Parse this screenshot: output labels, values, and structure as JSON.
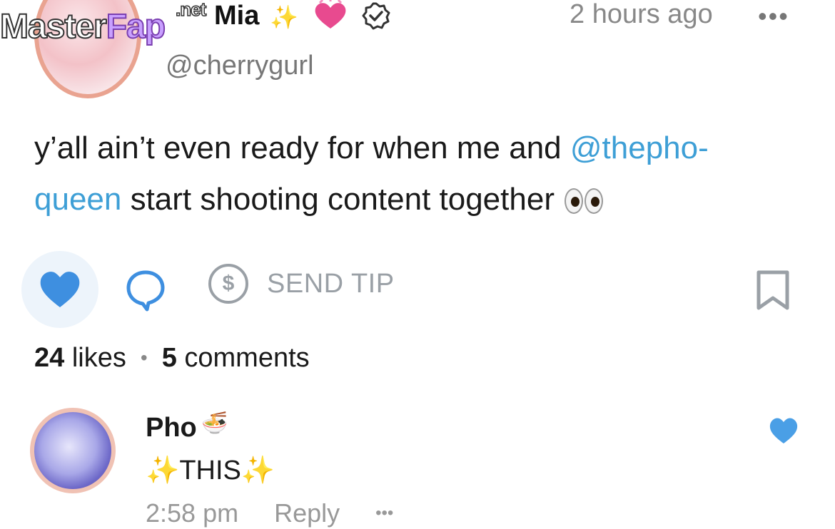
{
  "watermark": {
    "master": "Master",
    "fap": "Fap",
    "net": ".net"
  },
  "post": {
    "author_name": "Mia",
    "sparkles": "✨",
    "heart_emoji": "💗",
    "handle": "@cherrygurl",
    "timestamp": "2 hours ago",
    "more": "•••",
    "text_before": "y’all ain’t even ready for when me and ",
    "mention": "@thepho-queen",
    "text_after": " start shooting content together "
  },
  "actions": {
    "tip_symbol": "$",
    "send_tip_label": "SEND TIP"
  },
  "stats": {
    "likes_count": "24",
    "likes_label": "likes",
    "separator": "•",
    "comments_count": "5",
    "comments_label": "comments"
  },
  "comment": {
    "author_name": "Pho",
    "author_emoji": "🍜",
    "sparkle_left": "✨",
    "text": "THIS",
    "sparkle_right": "✨",
    "time": "2:58 pm",
    "reply_label": "Reply",
    "more": "•••"
  },
  "colors": {
    "like_blue": "#3e8fe0",
    "mention_blue": "#3e9fd6",
    "muted_gray": "#9aa0a6",
    "avatar_ring": "#e9a390"
  },
  "icons": [
    "heart-icon",
    "comment-bubble-icon",
    "dollar-icon",
    "bookmark-icon",
    "verified-badge-icon",
    "eyes-emoji",
    "noodle-bowl-emoji"
  ]
}
